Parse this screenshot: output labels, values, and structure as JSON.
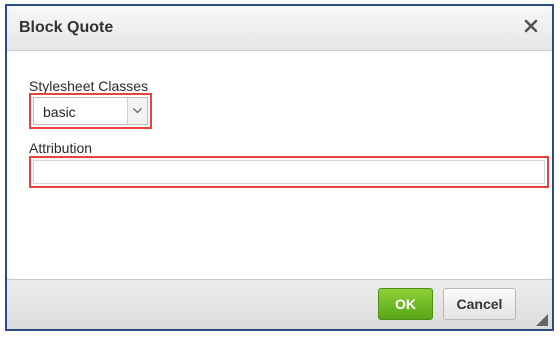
{
  "dialog": {
    "title": "Block Quote",
    "close_icon": "close-icon"
  },
  "stylesheet": {
    "label": "Stylesheet Classes",
    "selected": "basic",
    "dropdown_icon": "chevron-down-icon"
  },
  "attribution": {
    "label": "Attribution",
    "value": ""
  },
  "footer": {
    "ok_label": "OK",
    "cancel_label": "Cancel",
    "resize_icon": "resize-grip-icon"
  },
  "colors": {
    "highlight": "#e8443d",
    "ok_button": "#6cb922",
    "dialog_border": "#2a4d8a"
  }
}
